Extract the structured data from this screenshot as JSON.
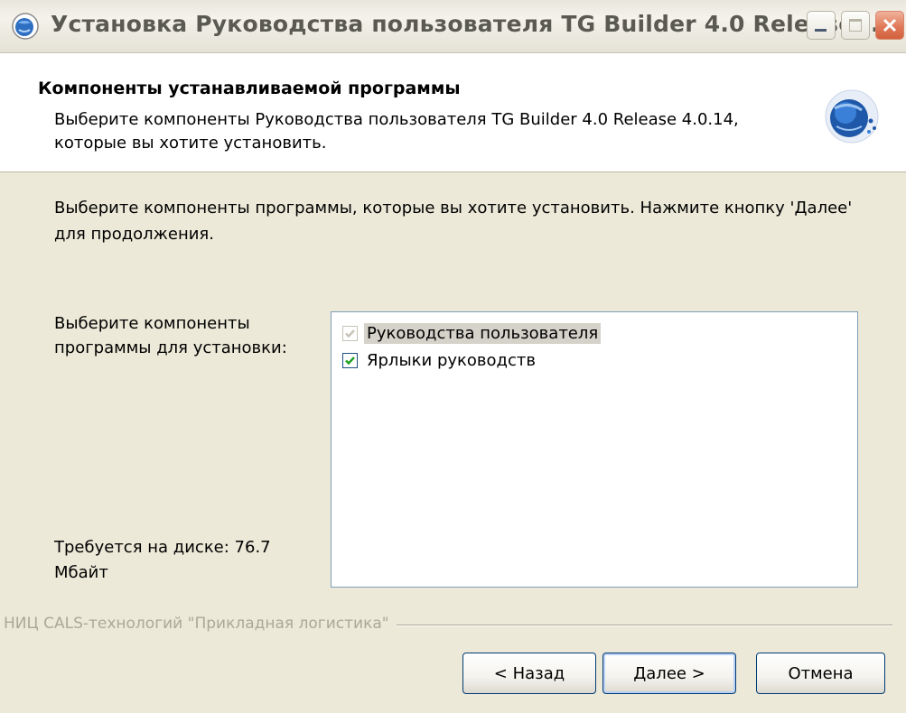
{
  "window": {
    "title": "Установка Руководства пользователя TG Builder 4.0 Release ...",
    "icon": "installer-globe-icon",
    "controls": [
      "minimize-icon",
      "maximize-icon",
      "close-icon"
    ]
  },
  "header": {
    "title": "Компоненты устанавливаемой программы",
    "description": "Выберите компоненты Руководства пользователя TG Builder 4.0 Release 4.0.14, которые вы хотите установить.",
    "logo": "installer-globe-icon"
  },
  "body": {
    "instruction": "Выберите компоненты программы, которые вы хотите установить. Нажмите кнопку 'Далее' для продолжения.",
    "select_label": "Выберите компоненты программы для установки:",
    "disk_label": "Требуется на диске: 76.7 Мбайт"
  },
  "components": [
    {
      "label": "Руководства пользователя",
      "checked": true,
      "disabled": true,
      "selected": true
    },
    {
      "label": "Ярлыки руководств",
      "checked": true,
      "disabled": false,
      "selected": false
    }
  ],
  "footer": {
    "brand": "НИЦ CALS-технологий \"Прикладная логистика\"",
    "back_label": "< Назад",
    "next_label": "Далее >",
    "cancel_label": "Отмена"
  },
  "colors": {
    "dialog_bg": "#ece9d8",
    "checkbox_check": "#21a121",
    "checkbox_check_disabled": "#c6c2b6",
    "button_border": "#003c74"
  }
}
